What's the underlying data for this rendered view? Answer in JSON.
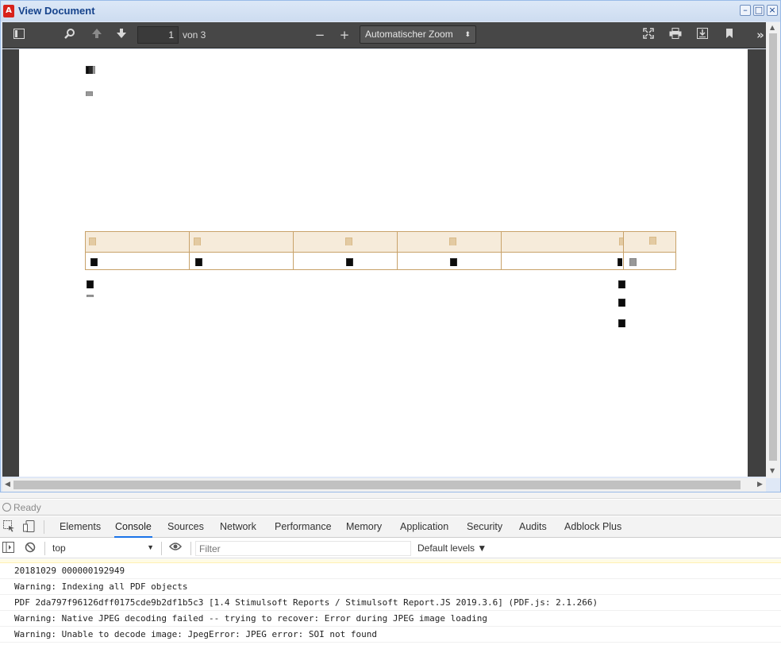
{
  "window": {
    "title": "View Document",
    "controls": {
      "minimize": "–",
      "maximize": "□",
      "close": "×"
    }
  },
  "toolbar": {
    "sidebar_icon": "sidebar-toggle-icon",
    "find_icon": "magnifier-icon",
    "page_number": "1",
    "page_of": "von 3",
    "zoom_out": "−",
    "zoom_in": "+",
    "zoom_value": "Automatischer Zoom",
    "presentation_icon": "fullscreen-icon",
    "print_icon": "printer-icon",
    "download_icon": "download-icon",
    "bookmark_icon": "bookmark-icon",
    "more_label": "»"
  },
  "status": {
    "text": "Ready"
  },
  "devtools": {
    "tabs": [
      "Elements",
      "Console",
      "Sources",
      "Network",
      "Performance",
      "Memory",
      "Application",
      "Security",
      "Audits",
      "Adblock Plus"
    ],
    "active_tab": "Console",
    "context": "top",
    "filter_placeholder": "Filter",
    "levels": "Default levels ▼"
  },
  "console": {
    "lines": [
      "20181029 000000192949",
      "Warning: Indexing all PDF objects",
      "PDF 2da797f96126dff0175cde9b2df1b5c3 [1.4 Stimulsoft Reports / Stimulsoft Report.JS 2019.3.6] (PDF.js: 2.1.266)",
      "Warning: Native JPEG decoding failed -- trying to recover: Error during JPEG image loading",
      "Warning: Unable to decode image: JpegError: JPEG error: SOI not found"
    ]
  },
  "colors": {
    "toolbar_bg": "#474747",
    "window_title": "#15428b",
    "table_border": "#c8a26a",
    "table_header_bg": "#f6ebda",
    "active_tab": "#1a73e8"
  }
}
